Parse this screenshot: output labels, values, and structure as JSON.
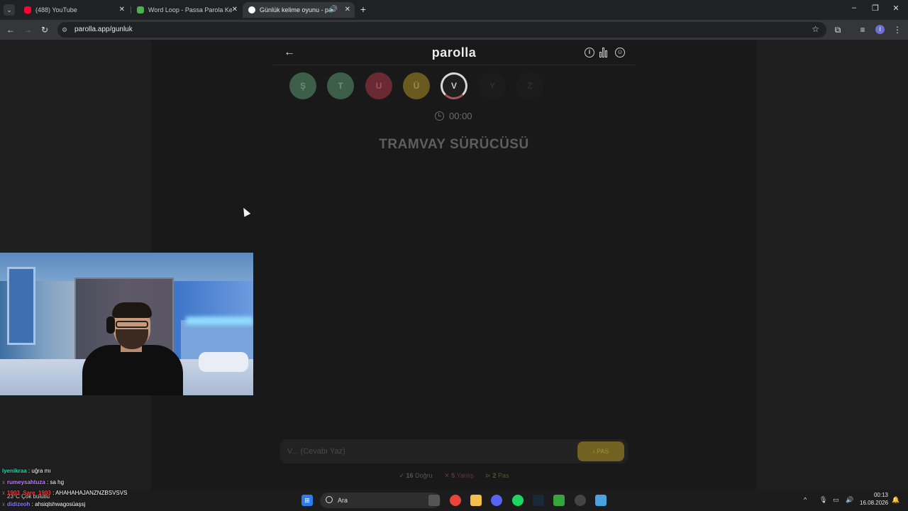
{
  "browser": {
    "tabs": [
      {
        "title": "(488) YouTube",
        "active": false,
        "favicon_color": "#ff0033"
      },
      {
        "title": "Word Loop - Passa Parola Kelim",
        "active": false,
        "favicon_color": "#4caf50"
      },
      {
        "title": "Günlük kelime oyunu - paro",
        "active": true,
        "favicon_color": "#ffffff"
      }
    ],
    "url": "parolla.app/gunluk",
    "profile_initial": "I"
  },
  "app": {
    "logo": "parolla",
    "letters": [
      {
        "char": "Ş",
        "status": "correct",
        "bg": "#3d5f49",
        "fg": "#6f8f79"
      },
      {
        "char": "T",
        "status": "correct",
        "bg": "#3d5f49",
        "fg": "#6f8f79"
      },
      {
        "char": "U",
        "status": "wrong",
        "bg": "#6b2a33",
        "fg": "#9b5560"
      },
      {
        "char": "Ü",
        "status": "pass",
        "bg": "#6b5a1f",
        "fg": "#9d8a46"
      },
      {
        "char": "V",
        "status": "current",
        "bg": "#1f1f1f",
        "fg": "#c9c9c9"
      },
      {
        "char": "Y",
        "status": "pending",
        "bg": "#1c1c1c",
        "fg": "#2f2f2f"
      },
      {
        "char": "Z",
        "status": "pending",
        "bg": "#1c1c1c",
        "fg": "#2f2f2f"
      }
    ],
    "timer": "00:00",
    "question": "TRAMVAY SÜRÜCÜSÜ",
    "answer_placeholder": "V... (Cevabı Yaz)",
    "pass_label": "› PAS",
    "stats": {
      "correct_count": "16",
      "correct_label": "Doğru",
      "wrong_count": "5",
      "wrong_label": "Yanlış",
      "pass_count": "2",
      "pass_label": "Pas"
    },
    "colors": {
      "correct": "#4e7a5c",
      "wrong": "#8a3a45",
      "pass": "#716122"
    }
  },
  "chat": [
    {
      "user": "lyenikraa",
      "message": "uğra mı",
      "user_color": "#2fd3a0",
      "prefix": ""
    },
    {
      "user": "rumeysahtuza",
      "message": "sa hg",
      "user_color": "#c07cff",
      "prefix": "x"
    },
    {
      "user": "1903_Sare_1903",
      "message": "AHAHAHAJANZNZBSVSVS",
      "user_color": "#ff3b3b",
      "prefix": "x"
    },
    {
      "user": "didizeoh",
      "message": "ahsiqlshwagosüaşsj",
      "user_color": "#8a7cff",
      "prefix": "x"
    }
  ],
  "taskbar": {
    "search_label": "Ara",
    "weather": "23°C Çok bulutlu",
    "time": "00:13",
    "date": "16.08.2026"
  }
}
